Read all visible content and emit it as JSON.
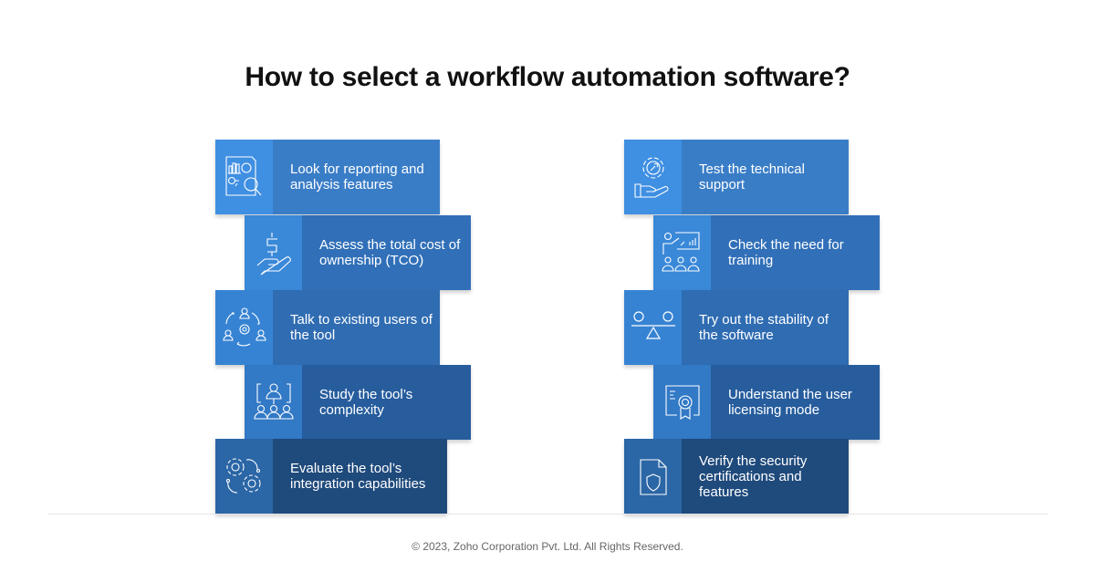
{
  "title": "How to select a workflow automation software?",
  "left_column": [
    {
      "label": "Look for reporting and analysis features",
      "icon": "report-analysis-icon"
    },
    {
      "label": "Assess the total cost of ownership (TCO)",
      "icon": "dollar-hand-icon"
    },
    {
      "label": "Talk to existing users of the tool",
      "icon": "users-cycle-icon"
    },
    {
      "label": "Study the tool’s complexity",
      "icon": "team-hierarchy-icon"
    },
    {
      "label": "Evaluate the tool’s integration capabilities",
      "icon": "gears-integration-icon"
    }
  ],
  "right_column": [
    {
      "label": "Test the technical support",
      "icon": "support-hand-icon"
    },
    {
      "label": "Check the need for training",
      "icon": "training-presentation-icon"
    },
    {
      "label": "Try out the stability of the software",
      "icon": "balance-scale-icon"
    },
    {
      "label": "Understand the user licensing mode",
      "icon": "license-certificate-icon"
    },
    {
      "label": "Verify the security certifications and features",
      "icon": "security-document-icon"
    }
  ],
  "footer": "© 2023, Zoho Corporation Pvt. Ltd. All Rights Reserved."
}
